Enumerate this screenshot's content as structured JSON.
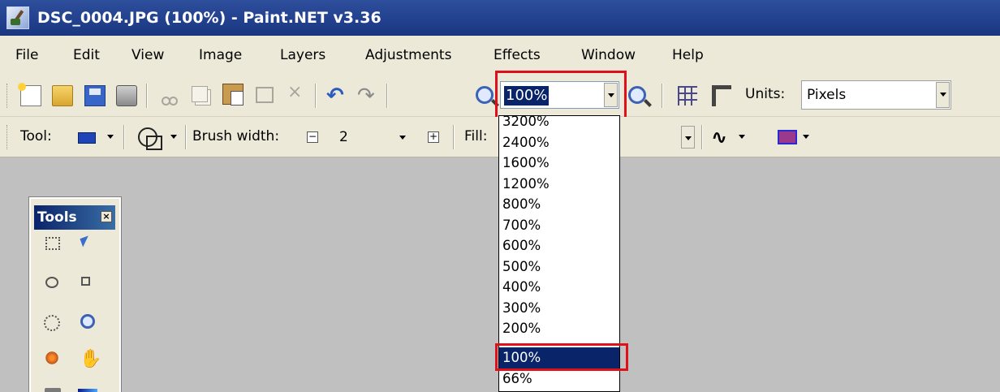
{
  "window": {
    "title": "DSC_0004.JPG (100%) - Paint.NET v3.36",
    "icon": "paintnet-app-icon"
  },
  "menu": [
    "File",
    "Edit",
    "View",
    "Image",
    "Layers",
    "Adjustments",
    "Effects",
    "Window",
    "Help"
  ],
  "toolbar": {
    "zoom_value": "100%",
    "units_label": "Units:",
    "units_value": "Pixels",
    "icons": [
      "new-icon",
      "open-icon",
      "save-icon",
      "print-icon",
      "cut-icon",
      "copy-icon",
      "paste-icon",
      "crop-icon",
      "deselect-icon",
      "undo-icon",
      "redo-icon",
      "zoom-out-icon",
      "zoom-in-icon",
      "grid-icon",
      "rulers-icon"
    ]
  },
  "tool_options": {
    "tool_label": "Tool:",
    "brush_width_label": "Brush width:",
    "brush_width_value": "2",
    "fill_label": "Fill:",
    "decrease_symbol": "−",
    "increase_symbol": "+"
  },
  "tools_window": {
    "title": "Tools",
    "close_symbol": "×",
    "tools": [
      "rectangle-select-icon",
      "move-selection-icon",
      "lasso-select-icon",
      "move-selected-icon",
      "ellipse-select-icon",
      "zoom-icon",
      "magic-wand-icon",
      "pan-icon",
      "paint-bucket-icon",
      "gradient-icon"
    ]
  },
  "zoom_dropdown": {
    "options": [
      "3200%",
      "2400%",
      "1600%",
      "1200%",
      "800%",
      "700%",
      "600%",
      "500%",
      "400%",
      "300%",
      "200%",
      "100%",
      "66%"
    ],
    "selected": "100%"
  },
  "colors": {
    "titlebar": "#234290",
    "selection": "#0a246a",
    "highlight_box": "#e0101b",
    "canvas_background": "#c0c0c0"
  }
}
